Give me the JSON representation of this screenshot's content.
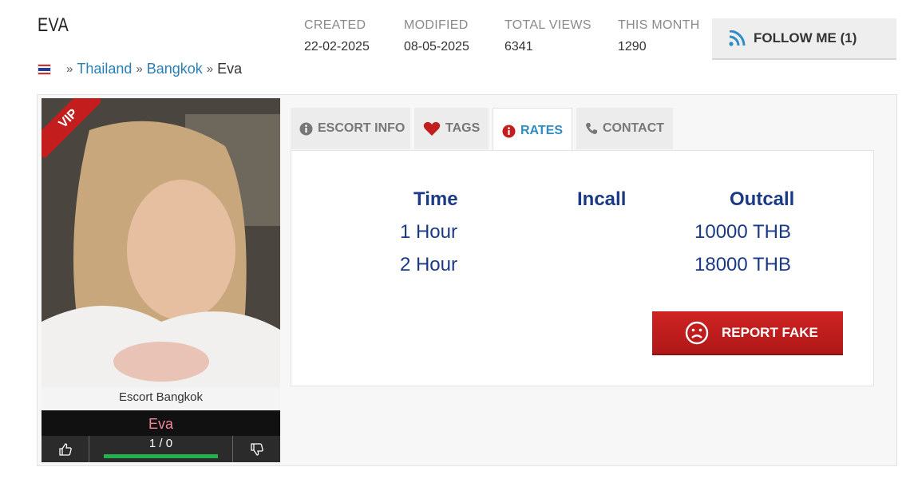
{
  "profile": {
    "name": "EVA",
    "caption": "Escort Bangkok",
    "display_name": "Eva",
    "badge": "VIP"
  },
  "stats": [
    {
      "label": "CREATED",
      "value": "22-02-2025"
    },
    {
      "label": "MODIFIED",
      "value": "08-05-2025"
    },
    {
      "label": "TOTAL VIEWS",
      "value": "6341"
    },
    {
      "label": "THIS MONTH",
      "value": "1290"
    }
  ],
  "follow": {
    "label": "FOLLOW ME (1)",
    "icon": "rss-icon"
  },
  "breadcrumb": {
    "sep": "»",
    "country": "Thailand",
    "city": "Bangkok",
    "current": "Eva",
    "flag_icon": "thailand-flag-icon"
  },
  "votes": {
    "score": "1 / 0",
    "up_icon": "thumbs-up-icon",
    "down_icon": "thumbs-down-icon",
    "ratio": 1.0
  },
  "tabs": [
    {
      "label": "ESCORT INFO",
      "icon": "info-icon",
      "active": false
    },
    {
      "label": "TAGS",
      "icon": "heart-icon",
      "active": false
    },
    {
      "label": "RATES",
      "icon": "info-icon",
      "active": true
    },
    {
      "label": "CONTACT",
      "icon": "phone-icon",
      "active": false
    }
  ],
  "rates": {
    "headers": {
      "time": "Time",
      "incall": "Incall",
      "outcall": "Outcall"
    },
    "rows": [
      {
        "time": "1 Hour",
        "incall": "",
        "outcall": "10000 THB"
      },
      {
        "time": "2 Hour",
        "incall": "",
        "outcall": "18000 THB"
      }
    ]
  },
  "report": {
    "label": "REPORT FAKE",
    "icon": "sad-face-icon"
  },
  "colors": {
    "accent_blue": "#2f8bc4",
    "rate_text": "#1b3a86",
    "report_red": "#c31d1d",
    "name_pink": "#f2879b",
    "vote_green": "#22b14c"
  }
}
